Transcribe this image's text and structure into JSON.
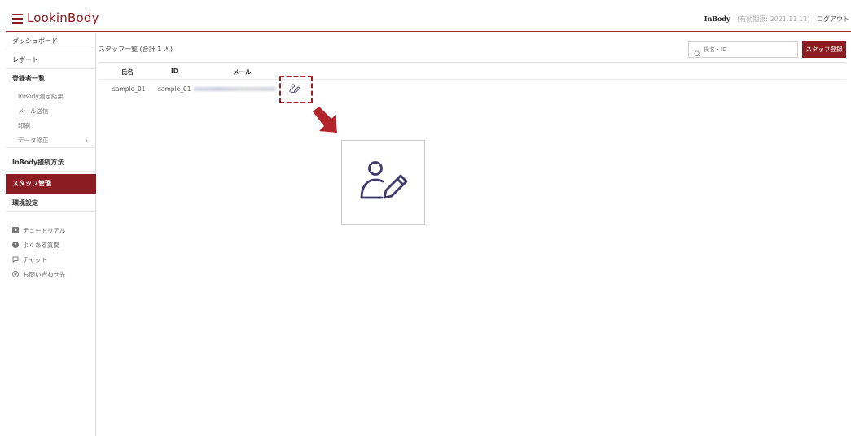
{
  "header": {
    "logo": "LookinBody",
    "inbody": "InBody",
    "expiry": "(有効期限: 2021.11.12)",
    "logout": "ログアウト"
  },
  "sidebar": {
    "items": [
      {
        "label": "ダッシュボード"
      },
      {
        "label": "レポート"
      },
      {
        "label": "登録者一覧"
      },
      {
        "label": "InBody接続方法"
      },
      {
        "label": "スタッフ管理"
      },
      {
        "label": "環境設定"
      }
    ],
    "subitems": [
      {
        "label": "InBody測定結果"
      },
      {
        "label": "メール送信"
      },
      {
        "label": "印刷"
      },
      {
        "label": "データ修正",
        "caret": "›"
      }
    ],
    "help": [
      {
        "label": "チュートリアル",
        "icon": "tutorial-icon"
      },
      {
        "label": "よくある質問",
        "icon": "faq-icon"
      },
      {
        "label": "チャット",
        "icon": "chat-icon"
      },
      {
        "label": "お問い合わせ先",
        "icon": "contact-icon"
      }
    ]
  },
  "main": {
    "title": "スタッフ一覧 (合計 1 人)",
    "search_placeholder": "氏名・ID",
    "register_button": "スタッフ登録",
    "columns": [
      "氏名",
      "ID",
      "メール"
    ],
    "rows": [
      {
        "name": "sample_01",
        "id": "sample_01"
      }
    ]
  },
  "colors": {
    "brand": "#8b1d22",
    "icon": "#3f3a6b"
  }
}
